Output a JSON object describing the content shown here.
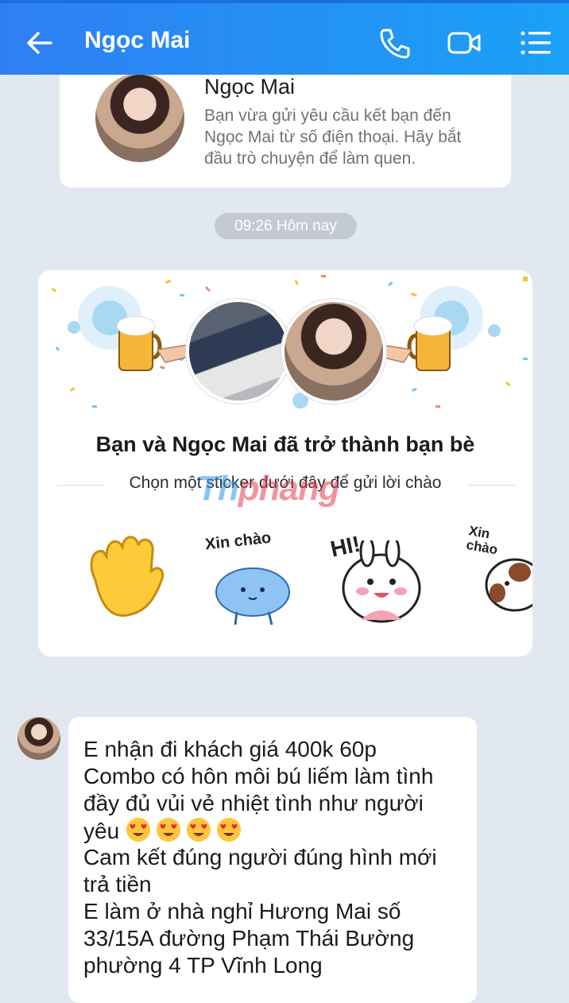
{
  "header": {
    "contact_name": "Ngọc Mai",
    "icons": [
      "back-arrow-icon",
      "phone-icon",
      "video-call-icon",
      "menu-icon"
    ]
  },
  "profile_card": {
    "name": "Ngọc Mai",
    "description_lines": [
      "Bạn vừa gửi yêu cầu kết bạn đến",
      "Ngọc Mai từ số điện thoại. Hãy bắt",
      "đầu trò chuyện để làm quen."
    ]
  },
  "timestamp": "09:26 Hôm nay",
  "friend_card": {
    "title": "Bạn và Ngọc Mai đã trở thành bạn bè",
    "subtitle": "Chọn một sticker dưới đây để gửi lời chào",
    "watermark": {
      "part1": "Th",
      "part2": "phang"
    },
    "stickers": [
      {
        "icon": "waving-hand-icon",
        "label": ""
      },
      {
        "icon": "blue-cat-icon",
        "label": "Xin chào"
      },
      {
        "icon": "bunny-icon",
        "label": "HI!"
      },
      {
        "icon": "dog-icon",
        "label": "Xin chào"
      }
    ]
  },
  "message": {
    "lines": [
      "E nhận đi khách giá 400k 60p",
      "Combo có hôn môi bú liếm làm tình",
      "đầy đủ vủi vẻ nhiệt tình như người",
      "yêu",
      "Cam kết đúng người đúng hình mới",
      "trả tiền",
      "E làm ở nhà nghỉ Hương Mai số",
      "33/15A đường Phạm Thái Bường",
      "phường 4 TP Vĩnh Long"
    ],
    "emoji_count": 4
  },
  "colors": {
    "header_gradient_start": "#2f7ff3",
    "header_gradient_end": "#1aa1f6",
    "background": "#e2e8ef",
    "pill": "#c4cad2"
  }
}
